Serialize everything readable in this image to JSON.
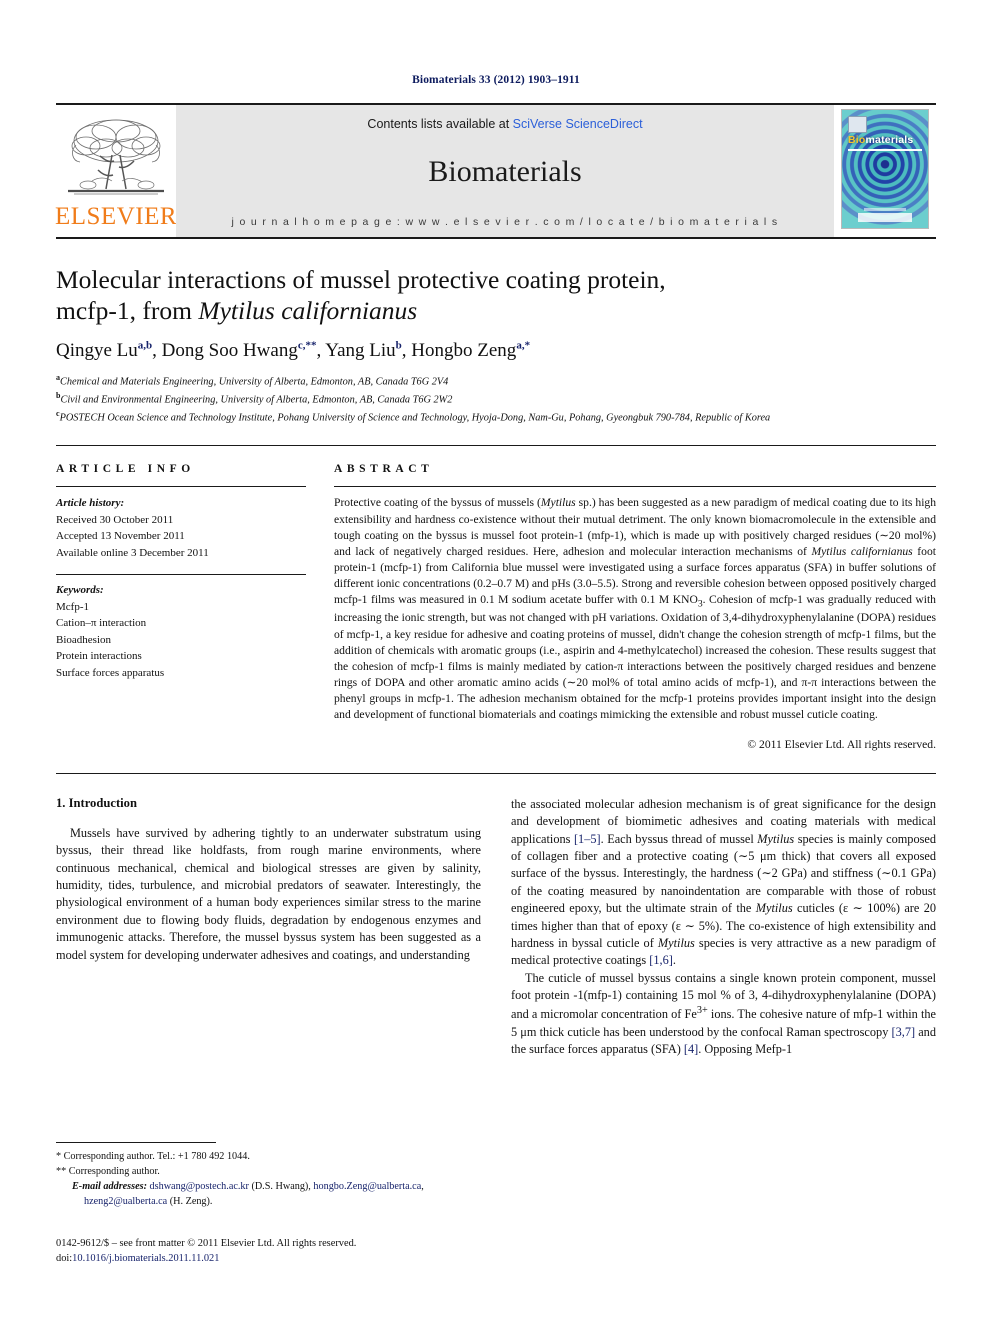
{
  "running_head": "Biomaterials 33 (2012) 1903–1911",
  "masthead": {
    "publisher_name": "ELSEVIER",
    "contents_prefix": "Contents lists available at ",
    "contents_link": "SciVerse ScienceDirect",
    "journal_title": "Biomaterials",
    "homepage": "j o u r n a l   h o m e p a g e :   w w w . e l s e v i e r . c o m / l o c a t e / b i o m a t e r i a l s",
    "cover": {
      "title_bio": "Bio",
      "title_rest": "materials"
    }
  },
  "title": {
    "line1": "Molecular interactions of mussel protective coating protein,",
    "line2_plain": "mcfp-1, from ",
    "line2_italic": "Mytilus californianus"
  },
  "authors": [
    {
      "name": "Qingye Lu",
      "sup": "a,b",
      "sep": ", "
    },
    {
      "name": "Dong Soo Hwang",
      "sup": "c,**",
      "sep": ", "
    },
    {
      "name": "Yang Liu",
      "sup": "b",
      "sep": ", "
    },
    {
      "name": "Hongbo Zeng",
      "sup": "a,*",
      "sep": ""
    }
  ],
  "affiliations": [
    {
      "mark": "a",
      "text": "Chemical and Materials Engineering, University of Alberta, Edmonton, AB, Canada T6G 2V4"
    },
    {
      "mark": "b",
      "text": "Civil and Environmental Engineering, University of Alberta, Edmonton, AB, Canada T6G 2W2"
    },
    {
      "mark": "c",
      "text": "POSTECH Ocean Science and Technology Institute, Pohang University of Science and Technology, Hyoja-Dong, Nam-Gu, Pohang, Gyeongbuk 790-784, Republic of Korea"
    }
  ],
  "article_info": {
    "heading": "ARTICLE INFO",
    "history_label": "Article history:",
    "history": [
      "Received 30 October 2011",
      "Accepted 13 November 2011",
      "Available online 3 December 2011"
    ],
    "keywords_label": "Keywords:",
    "keywords": [
      "Mcfp-1",
      "Cation–π interaction",
      "Bioadhesion",
      "Protein interactions",
      "Surface forces apparatus"
    ]
  },
  "abstract": {
    "heading": "ABSTRACT",
    "p1_a": "Protective coating of the byssus of mussels (",
    "p1_i1": "Mytilus",
    "p1_b": " sp.) has been suggested as a new paradigm of medical coating due to its high extensibility and hardness co-existence without their mutual detriment. The only known biomacromolecule in the extensible and tough coating on the byssus is mussel foot protein-1 (mfp-1), which is made up with positively charged residues (∼20 mol%) and lack of negatively charged residues. Here, adhesion and molecular interaction mechanisms of ",
    "p1_i2": "Mytilus californianus",
    "p1_c": " foot protein-1 (mcfp-1) from California blue mussel were investigated using a surface forces apparatus (SFA) in buffer solutions of different ionic concentrations (0.2–0.7 M) and pHs (3.0–5.5). Strong and reversible cohesion between opposed positively charged mcfp-1 films was measured in 0.1 M sodium acetate buffer with 0.1 M KNO",
    "p1_sub": "3",
    "p1_d": ". Cohesion of mcfp-1 was gradually reduced with increasing the ionic strength, but was not changed with pH variations. Oxidation of 3,4-dihydroxyphenylalanine (DOPA) residues of mcfp-1, a key residue for adhesive and coating proteins of mussel, didn't change the cohesion strength of mcfp-1 films, but the addition of chemicals with aromatic groups (i.e., aspirin and 4-methylcatechol) increased the cohesion. These results suggest that the cohesion of mcfp-1 films is mainly mediated by cation-π interactions between the positively charged residues and benzene rings of DOPA and other aromatic amino acids (∼20 mol% of total amino acids of mcfp-1), and π-π interactions between the phenyl groups in mcfp-1. The adhesion mechanism obtained for the mcfp-1 proteins provides important insight into the design and development of functional biomaterials and coatings mimicking the extensible and robust mussel cuticle coating.",
    "copyright": "© 2011 Elsevier Ltd. All rights reserved."
  },
  "introduction": {
    "heading": "1.  Introduction",
    "left_p1": "Mussels have survived by adhering tightly to an underwater substratum using byssus, their thread like holdfasts, from rough marine environments, where continuous mechanical, chemical and biological stresses are given by salinity, humidity, tides, turbulence, and microbial predators of seawater. Interestingly, the physiological environment of a human body experiences similar stress to the marine environment due to flowing body fluids, degradation by endogenous enzymes and immunogenic attacks. Therefore, the mussel byssus system has been suggested as a model system for developing underwater adhesives and coatings, and understanding",
    "right_p1_a": "the associated molecular adhesion mechanism is of great significance for the design and development of biomimetic adhesives and coating materials with medical applications ",
    "right_p1_ref1": "[1–5]",
    "right_p1_b": ". Each byssus thread of mussel ",
    "right_p1_i1": "Mytilus",
    "right_p1_c": " species is mainly composed of collagen fiber and a protective coating (∼5 μm thick) that covers all exposed surface of the byssus. Interestingly, the hardness (∼2 GPa) and stiffness (∼0.1 GPa) of the coating measured by nanoindentation are comparable with those of robust engineered epoxy, but the ultimate strain of the ",
    "right_p1_i2": "Mytilus",
    "right_p1_d": " cuticles (ε ∼ 100%) are 20 times higher than that of epoxy (ε ∼ 5%). The co-existence of high extensibility and hardness in byssal cuticle of ",
    "right_p1_i3": "Mytilus",
    "right_p1_e": " species is very attractive as a new paradigm of medical protective coatings ",
    "right_p1_ref2": "[1,6]",
    "right_p1_f": ".",
    "right_p2_a": "The cuticle of mussel byssus contains a single known protein component, mussel foot protein -1(mfp-1) containing 15 mol % of 3, 4-dihydroxyphenylalanine (DOPA) and a micromolar concentration of Fe",
    "right_p2_sup": "3+",
    "right_p2_b": " ions. The cohesive nature of mfp-1 within the 5 μm thick cuticle has been understood by the confocal Raman spectroscopy ",
    "right_p2_ref1": "[3,7]",
    "right_p2_c": " and the surface forces apparatus (SFA) ",
    "right_p2_ref2": "[4]",
    "right_p2_d": ". Opposing Mefp-1"
  },
  "footnotes": {
    "line1": "*  Corresponding author. Tel.: +1 780 492 1044.",
    "line2": "**  Corresponding author.",
    "email_label": "E-mail addresses:",
    "email1": "dshwang@postech.ac.kr",
    "email1_who": " (D.S. Hwang), ",
    "email2": "hongbo.Zeng@ualberta.ca",
    "email2_sep": ", ",
    "email3": "hzeng2@ualberta.ca",
    "email3_who": " (H. Zeng).",
    "issn_line": "0142-9612/$ – see front matter © 2011 Elsevier Ltd. All rights reserved.",
    "doi_label": "doi:",
    "doi_value": "10.1016/j.biomaterials.2011.11.021"
  }
}
